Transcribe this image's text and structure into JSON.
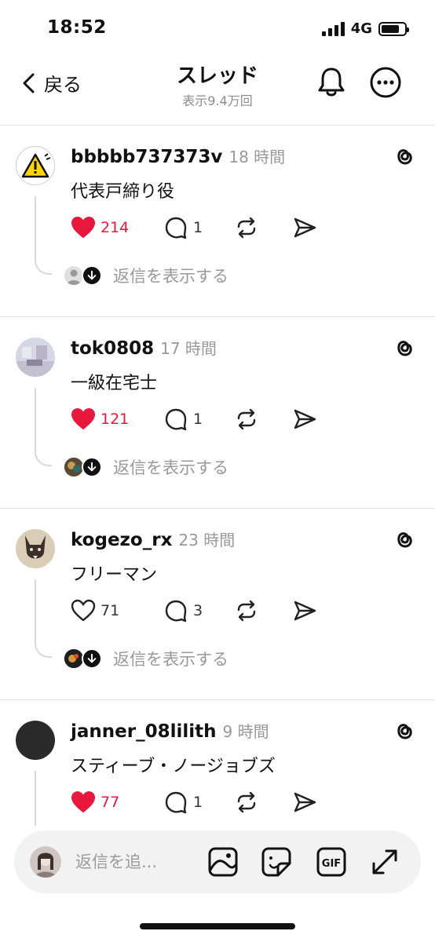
{
  "status_bar": {
    "time": "18:52",
    "network": "4G"
  },
  "nav": {
    "back_label": "戻る",
    "title": "スレッド",
    "subtitle": "表示9.4万回"
  },
  "posts": [
    {
      "username": "bbbbb737373v",
      "time": "18 時間",
      "text": "代表戸締り役",
      "likes": "214",
      "liked": true,
      "comments": "1",
      "replies_label": "返信を表示する"
    },
    {
      "username": "tok0808",
      "time": "17 時間",
      "text": "一級在宅士",
      "likes": "121",
      "liked": true,
      "comments": "1",
      "replies_label": "返信を表示する"
    },
    {
      "username": "kogezo_rx",
      "time": "23 時間",
      "text": "フリーマン",
      "likes": "71",
      "liked": false,
      "comments": "3",
      "replies_label": "返信を表示する"
    },
    {
      "username": "janner_08lilith",
      "time": "9 時間",
      "text": "スティーブ・ノージョブズ",
      "likes": "77",
      "liked": true,
      "comments": "1"
    }
  ],
  "composer": {
    "placeholder": "返信を追..."
  },
  "colors": {
    "like": "#e8173d",
    "muted": "#999999",
    "divider": "#e3e3e3"
  },
  "icons": [
    "back-chevron-icon",
    "bell-icon",
    "more-icon",
    "threads-icon",
    "heart-icon",
    "comment-icon",
    "repost-icon",
    "share-icon",
    "image-icon",
    "sticker-icon",
    "gif-icon",
    "expand-icon"
  ]
}
